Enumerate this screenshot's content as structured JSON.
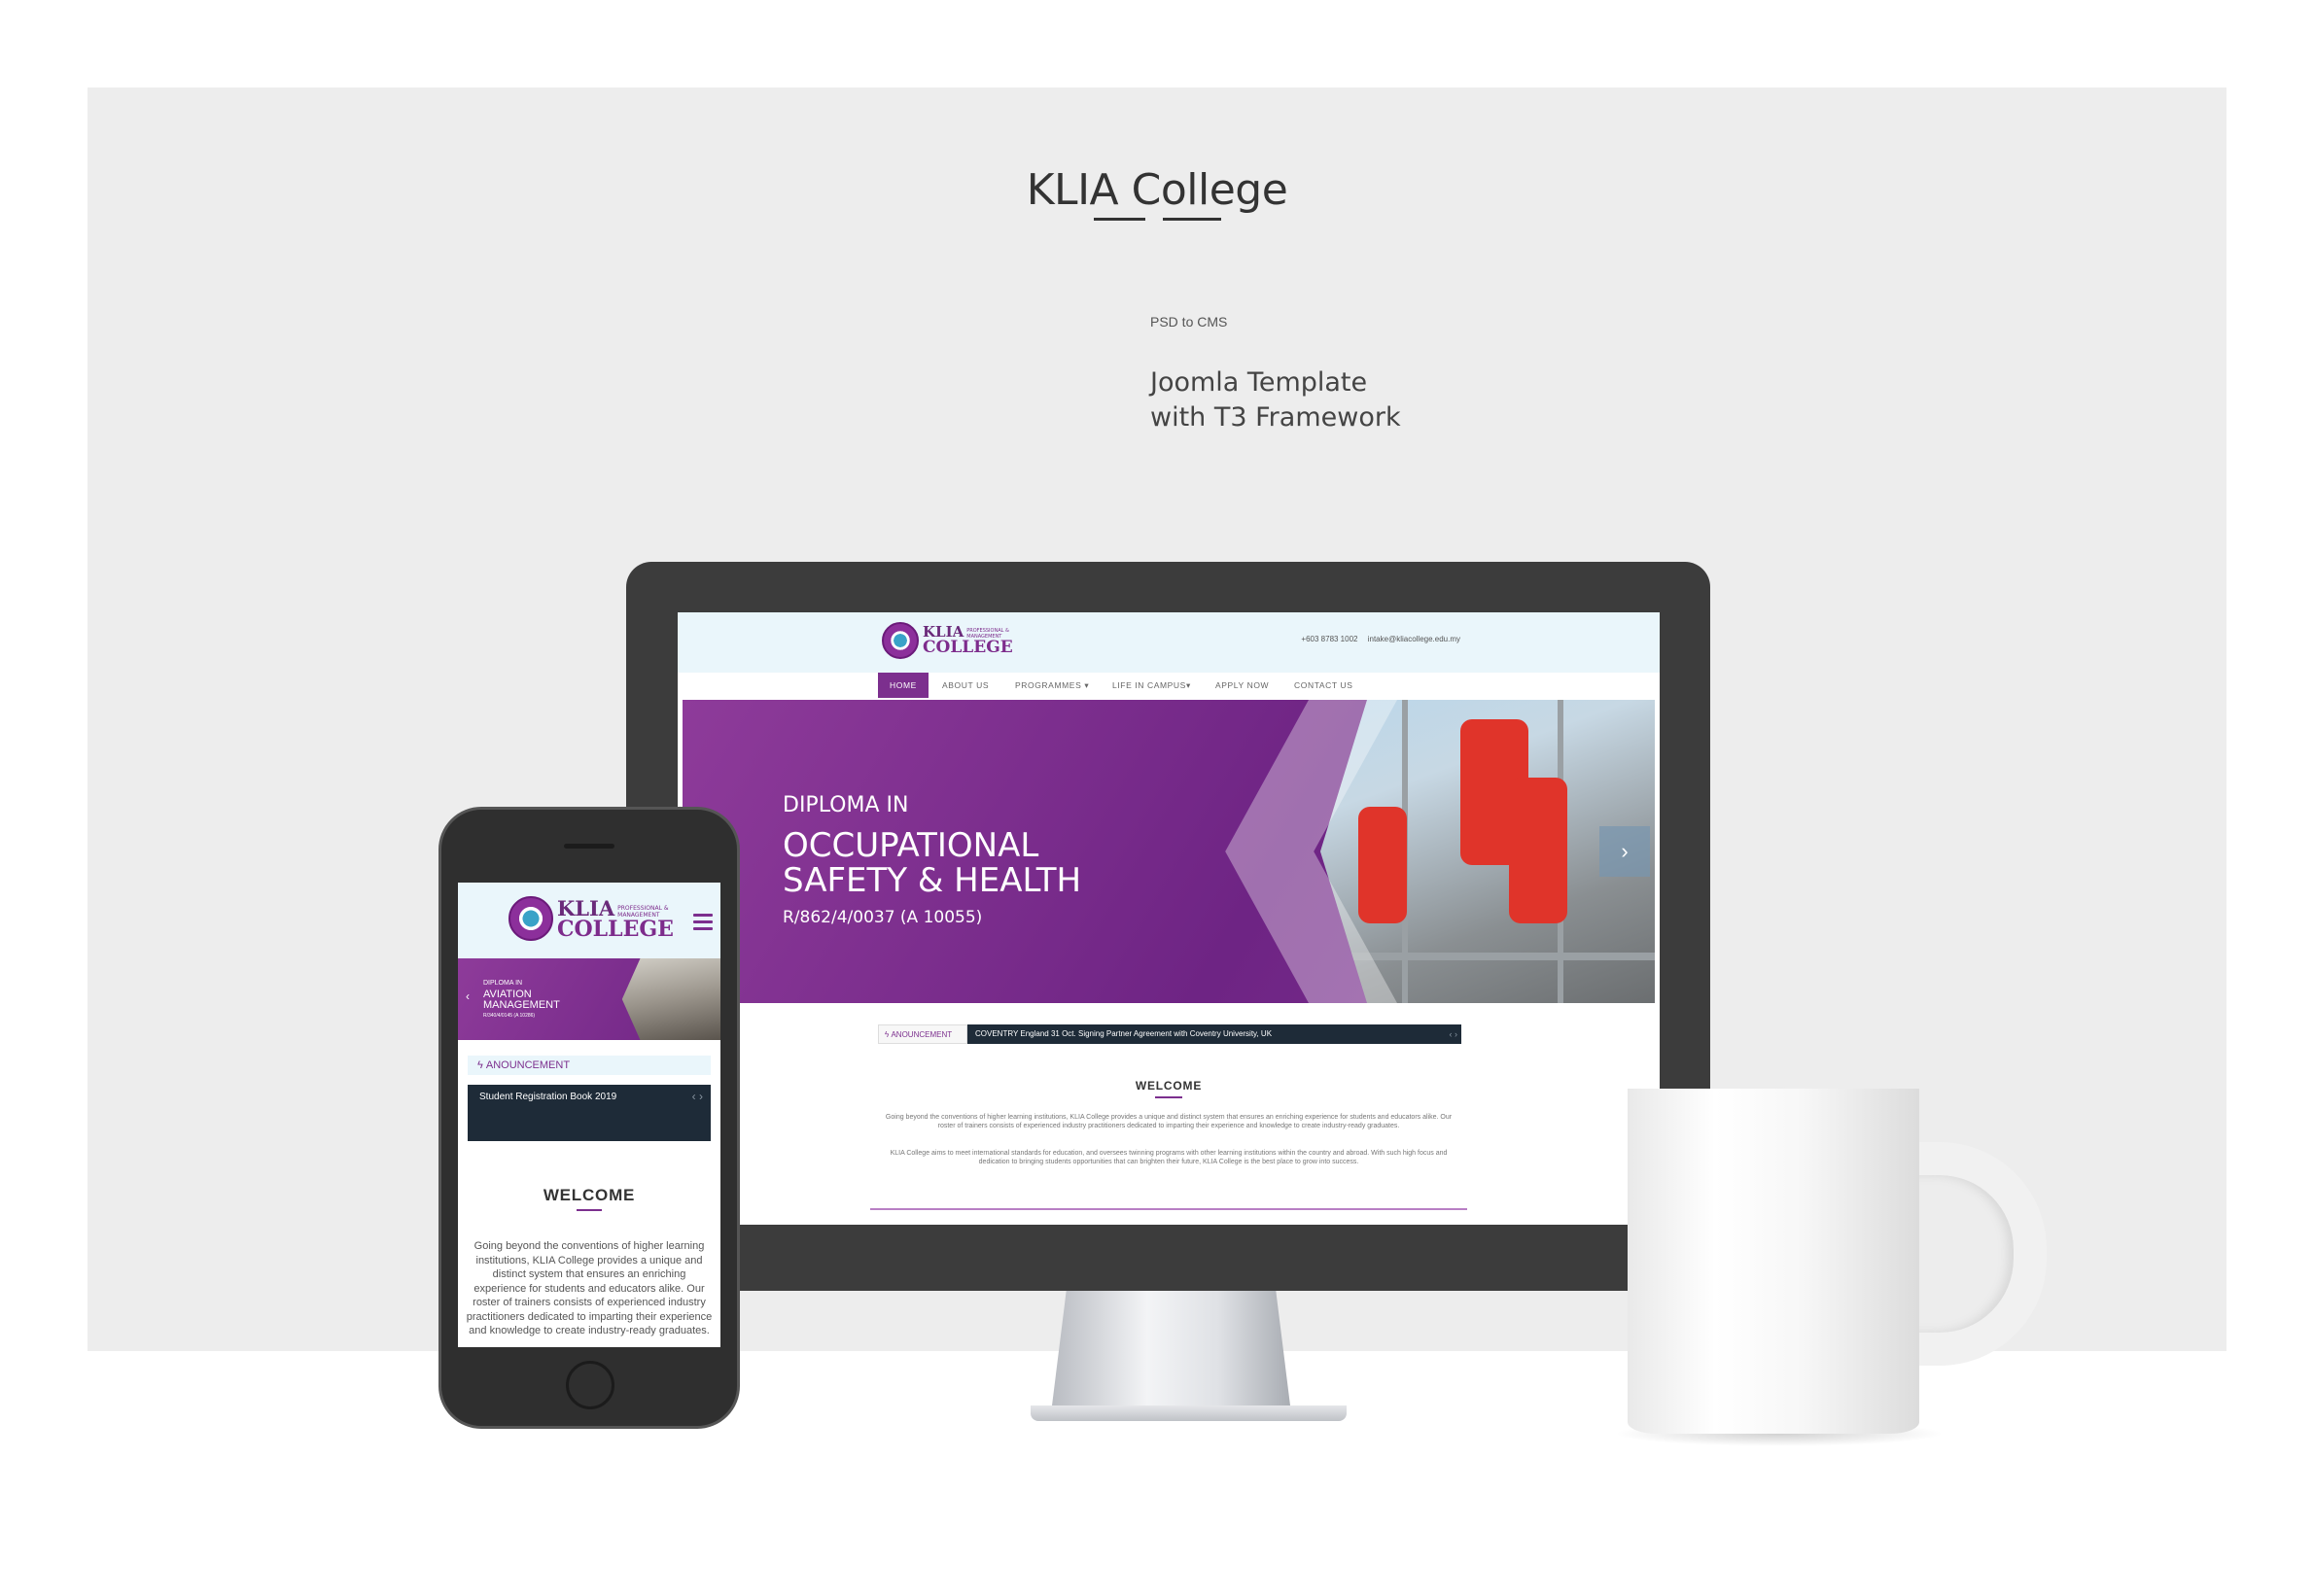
{
  "showcase": {
    "title": "KLIA College",
    "subtitle": "PSD to CMS",
    "description_line1": "Joomla Template",
    "description_line2": "with T3 Framework"
  },
  "site": {
    "logo": {
      "primary": "KLIA",
      "secondary": "COLLEGE",
      "tagline1": "PROFESSIONAL &",
      "tagline2": "MANAGEMENT"
    },
    "contact": {
      "phone": "+603 8783 1002",
      "email": "intake@kliacollege.edu.my"
    },
    "nav": [
      "HOME",
      "ABOUT US",
      "PROGRAMMES",
      "LIFE IN CAMPUS",
      "APPLY NOW",
      "CONTACT US"
    ],
    "hero": {
      "pre_title": "DIPLOMA IN",
      "title_line1": "OCCUPATIONAL",
      "title_line2": "SAFETY & HEALTH",
      "code": "R/862/4/0037 (A 10055)"
    },
    "announcement": {
      "label": "ANOUNCEMENT",
      "text": "COVENTRY England 31 Oct. Signing Partner Agreement with Coventry University, UK"
    },
    "welcome": {
      "heading": "WELCOME",
      "para1": "Going beyond the conventions of higher learning institutions, KLIA College provides a unique and distinct system that ensures an enriching experience for students and educators alike. Our roster of trainers consists of experienced industry practitioners dedicated to imparting their experience and knowledge to create industry-ready graduates.",
      "para2": "KLIA College aims to meet international standards for education, and oversees twinning programs with other learning institutions within the country and abroad. With such high focus and dedication to bringing students opportunities that can brighten their future, KLIA College is the best place to grow into success."
    }
  },
  "mobile": {
    "hero": {
      "pre_title": "DIPLOMA IN",
      "title_line1": "AVIATION",
      "title_line2": "MANAGEMENT",
      "code": "R/340/4/0145 (A 10286)"
    },
    "announcement": {
      "label": "ANOUNCEMENT",
      "text": "Student Registration Book 2019"
    },
    "welcome": {
      "heading": "WELCOME",
      "text": "Going beyond the conventions of higher learning institutions, KLIA College provides a unique and distinct system that ensures an enriching experience for students and educators alike. Our roster of trainers consists of experienced industry practitioners dedicated to imparting their experience and knowledge to create industry-ready graduates."
    }
  },
  "colors": {
    "brand_purple": "#7c2f8e",
    "header_bg": "#eaf6fb",
    "announcement_bg": "#1e2b38"
  }
}
